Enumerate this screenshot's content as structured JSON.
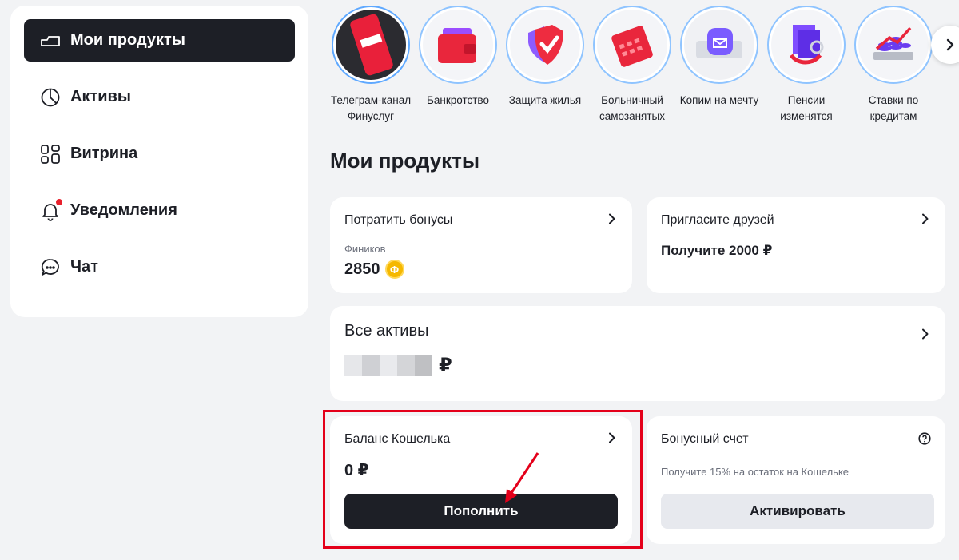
{
  "sidebar": {
    "items": [
      {
        "label": "Мои продукты",
        "icon": "products-icon",
        "active": true
      },
      {
        "label": "Активы",
        "icon": "pie-chart-icon"
      },
      {
        "label": "Витрина",
        "icon": "grid-icon"
      },
      {
        "label": "Уведомления",
        "icon": "bell-icon",
        "badge": true
      },
      {
        "label": "Чат",
        "icon": "chat-icon"
      }
    ]
  },
  "stories": [
    {
      "label": "Телеграм-канал\nФинуслуг",
      "icon": "phone-telegram-icon"
    },
    {
      "label": "Банкротство",
      "icon": "wallet-icon"
    },
    {
      "label": "Защита жилья",
      "icon": "shield-icon"
    },
    {
      "label": "Больничный\nсамозанятых",
      "icon": "calculator-icon"
    },
    {
      "label": "Копим на мечту",
      "icon": "envelope-icon"
    },
    {
      "label": "Пенсии\nизменятся",
      "icon": "documents-icon"
    },
    {
      "label": "Ставки по\nкредитам",
      "icon": "coins-chart-icon"
    }
  ],
  "main": {
    "title": "Мои продукты",
    "bonuses": {
      "title": "Потратить бонусы",
      "unit": "Фиников",
      "value": "2850",
      "coin_symbol": "Ф"
    },
    "invite": {
      "title": "Пригласите друзей",
      "value": "Получите 2000 ₽"
    },
    "assets": {
      "title": "Все активы",
      "currency": "₽"
    },
    "wallet": {
      "title": "Баланс Кошелька",
      "value": "0 ₽",
      "button": "Пополнить"
    },
    "bonus_account": {
      "title": "Бонусный счет",
      "note": "Получите 15% на остаток на Кошельке",
      "button": "Активировать"
    }
  },
  "colors": {
    "dark": "#1d1f26",
    "accent_red": "#e4001a",
    "story_ring": "#8fc4ff",
    "coin": "#f5b800"
  }
}
